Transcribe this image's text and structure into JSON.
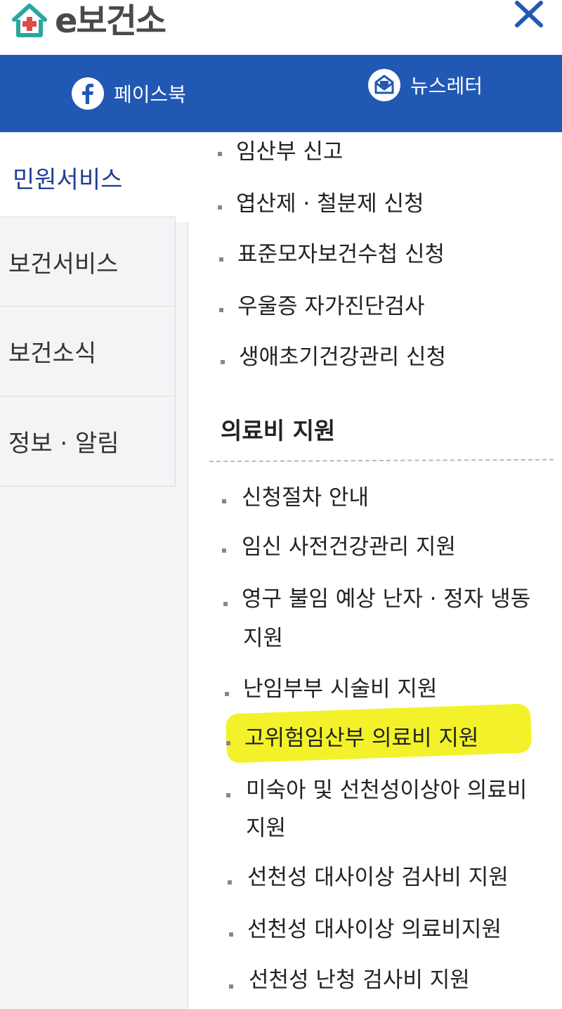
{
  "header": {
    "logo_text": "e보건소",
    "logo_icon": "house-plus-icon",
    "close_icon": "close-icon"
  },
  "social": {
    "facebook_label": "페이스북",
    "newsletter_label": "뉴스레터"
  },
  "nav": {
    "items": [
      {
        "label": "민원서비스",
        "active": true
      },
      {
        "label": "보건서비스",
        "active": false
      },
      {
        "label": "보건소식",
        "active": false
      },
      {
        "label": "정보 · 알림",
        "active": false
      }
    ]
  },
  "menu": {
    "top_links": [
      "임산부 신고",
      "엽산제 · 철분제 신청",
      "표준모자보건수첩 신청",
      "우울증 자가진단검사",
      "생애초기건강관리 신청"
    ],
    "section_title": "의료비 지원",
    "section_links": [
      "신청절차 안내",
      "임신 사전건강관리 지원",
      "영구 불임 예상 난자 · 정자 냉동",
      "지원",
      "난임부부 시술비 지원",
      "고위험임산부 의료비 지원",
      "미숙아 및 선천성이상아 의료비",
      "지원",
      "선천성 대사이상 검사비 지원",
      "선천성 대사이상 의료비지원",
      "선천성 난청 검사비 지원"
    ],
    "highlighted_item": "고위험임산부 의료비 지원"
  },
  "colors": {
    "brand_blue": "#2158b3",
    "nav_active_text": "#1e3f95",
    "highlight": "#f3f22a",
    "logo_teal": "#2aa6a0"
  }
}
